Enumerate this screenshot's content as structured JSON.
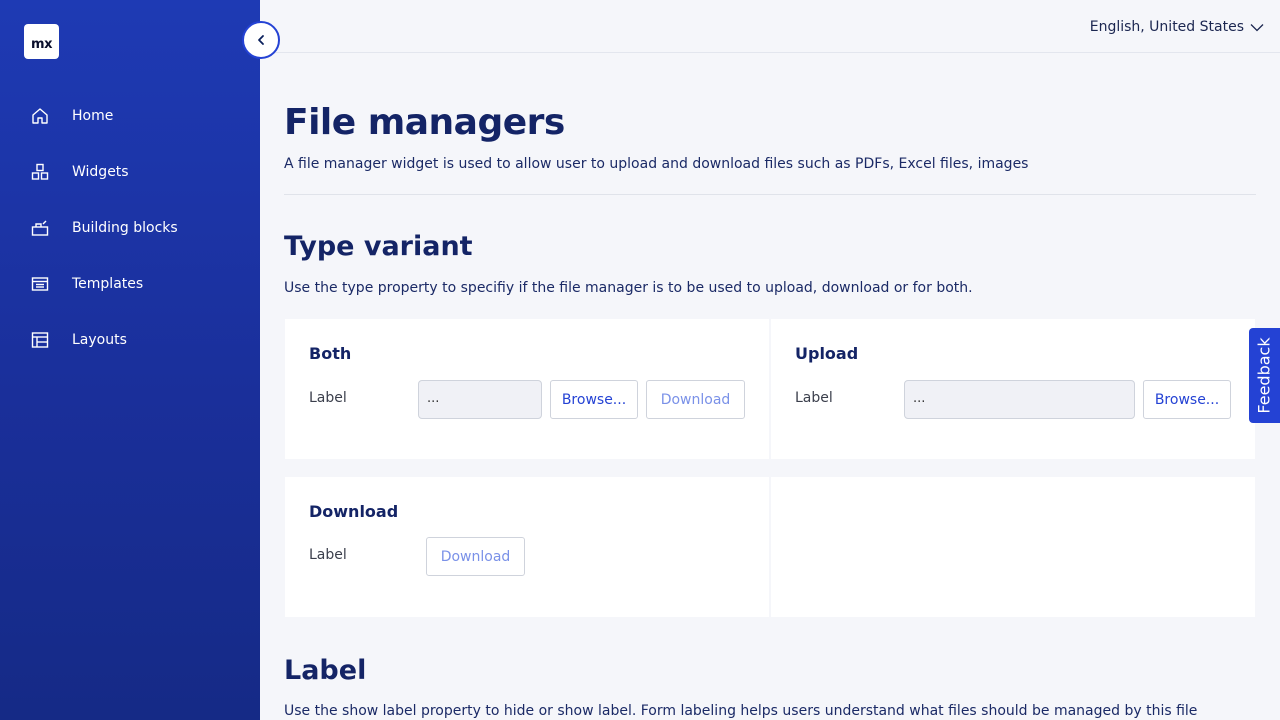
{
  "app": {
    "logo_text": "mx"
  },
  "sidebar": {
    "items": [
      {
        "label": "Home",
        "icon": "home-icon"
      },
      {
        "label": "Widgets",
        "icon": "widgets-icon"
      },
      {
        "label": "Building blocks",
        "icon": "building-blocks-icon"
      },
      {
        "label": "Templates",
        "icon": "templates-icon"
      },
      {
        "label": "Layouts",
        "icon": "layouts-icon"
      }
    ]
  },
  "header": {
    "language": "English, United States"
  },
  "page": {
    "title": "File managers",
    "description": "A file manager widget is used to allow user to upload and download files such as PDFs, Excel files, images"
  },
  "sections": {
    "type_variant": {
      "title": "Type variant",
      "description": "Use the type property to specifiy if the file manager is to be used to upload, download or for both.",
      "cards": {
        "both": {
          "title": "Both",
          "label": "Label",
          "input_value": "...",
          "browse": "Browse...",
          "download": "Download"
        },
        "upload": {
          "title": "Upload",
          "label": "Label",
          "input_value": "...",
          "browse": "Browse..."
        },
        "download": {
          "title": "Download",
          "label": "Label",
          "download": "Download"
        }
      }
    },
    "label": {
      "title": "Label",
      "description": "Use the show label property to hide or show label. Form labeling helps users understand what files should be managed by this file"
    }
  },
  "feedback": {
    "label": "Feedback"
  },
  "colors": {
    "accent": "#2442d4",
    "sidebar": "#1e3ab4",
    "heading": "#142466"
  }
}
